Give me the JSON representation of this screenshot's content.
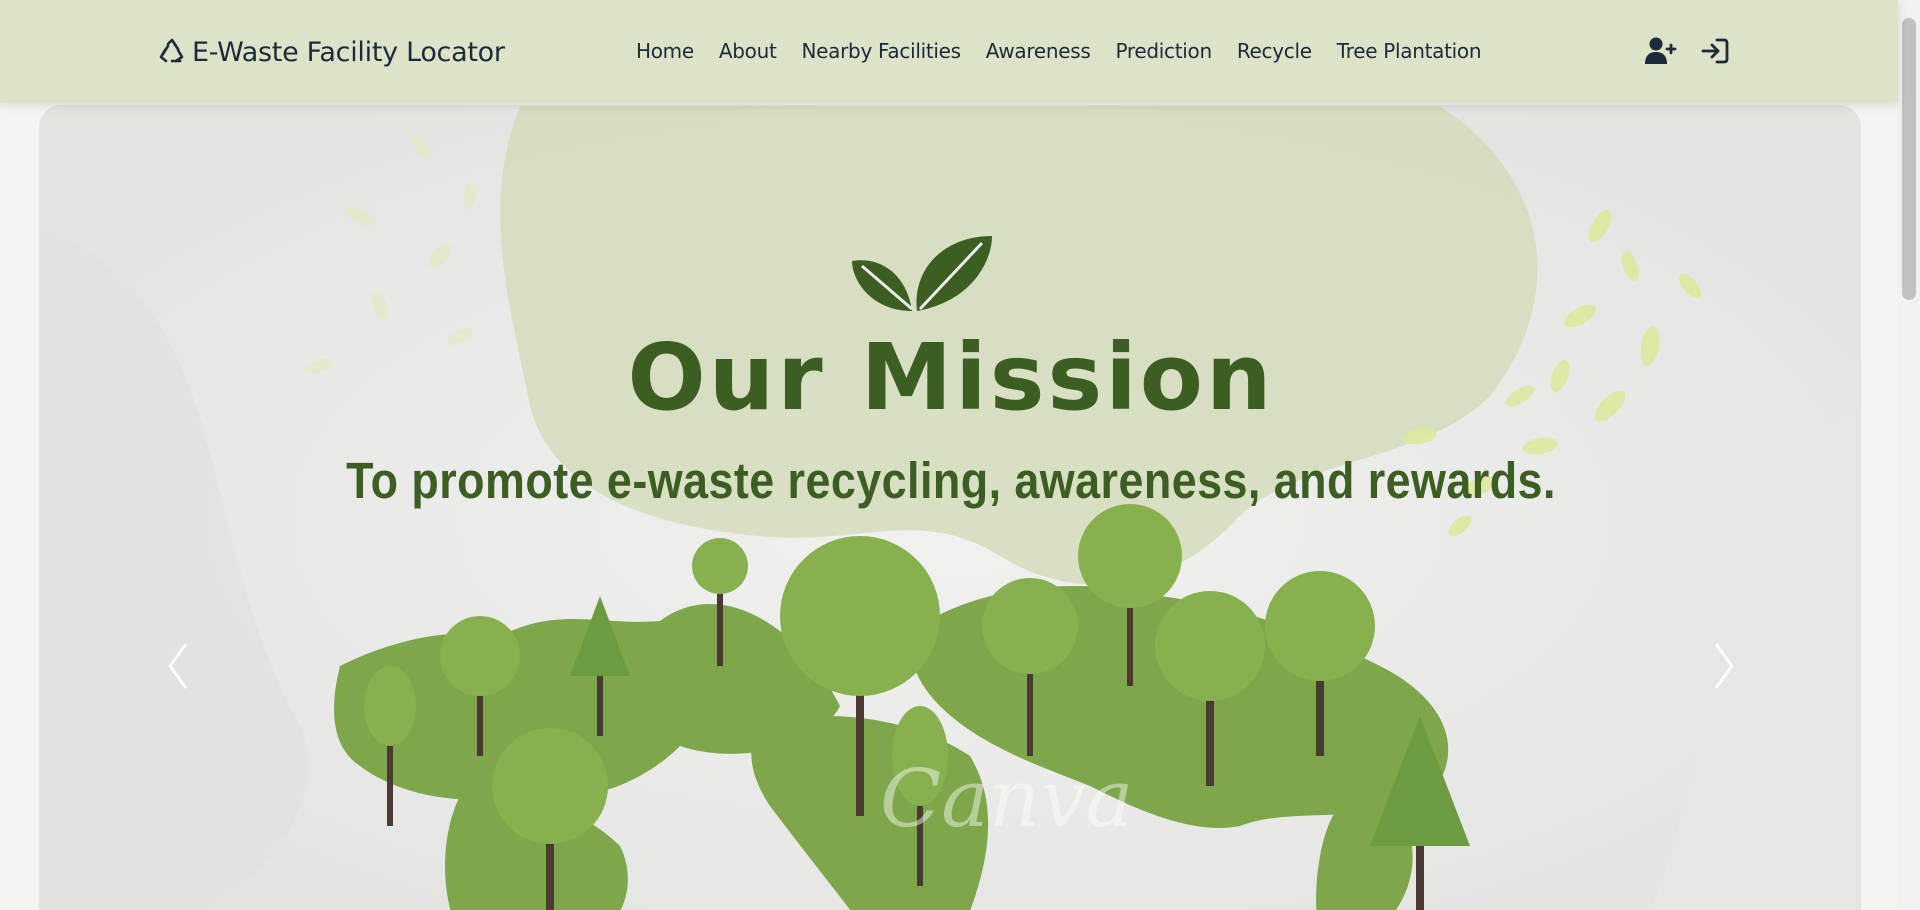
{
  "brand": {
    "icon": "recycle-icon",
    "title": "E-Waste Facility Locator"
  },
  "nav": {
    "links": [
      {
        "label": "Home"
      },
      {
        "label": "About"
      },
      {
        "label": "Nearby Facilities"
      },
      {
        "label": "Awareness"
      },
      {
        "label": "Prediction"
      },
      {
        "label": "Recycle"
      },
      {
        "label": "Tree Plantation"
      }
    ],
    "icons": [
      "user-plus-icon",
      "sign-in-icon"
    ]
  },
  "hero": {
    "title": "Our Mission",
    "subtitle": "To promote e-waste recycling, awareness, and rewards.",
    "watermark": "Canva",
    "controls": [
      "chevron-left-icon",
      "chevron-right-icon"
    ]
  },
  "colors": {
    "navbar": "#dde3c9",
    "brand_text": "#1d2a3a",
    "accent_green": "#3d5e22",
    "land_green": "#7da74a"
  }
}
